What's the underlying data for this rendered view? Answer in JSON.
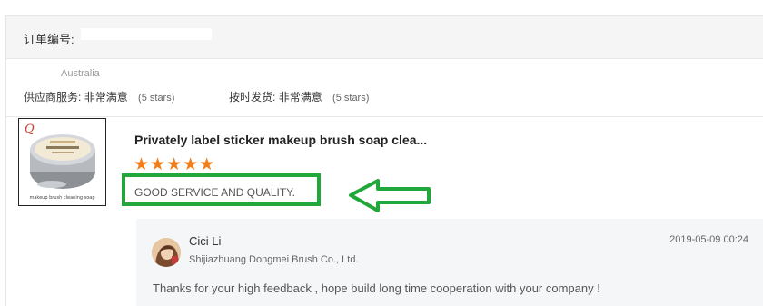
{
  "order": {
    "number_label": "订单编号:"
  },
  "buyer": {
    "country": "Australia"
  },
  "ratings": {
    "supplier_service": {
      "label": "供应商服务:",
      "value": "非常满意",
      "note": "(5 stars)"
    },
    "on_time_shipping": {
      "label": "按时发货:",
      "value": "非常满意",
      "note": "(5 stars)"
    }
  },
  "product": {
    "title": "Privately label sticker makeup brush soap clea...",
    "thumbnail_caption": "makeup brush cleaning soap",
    "stars_display": "★★★★★",
    "star_rating": 5,
    "star_color": "#f07f1a",
    "review_text": "GOOD SERVICE AND QUALITY."
  },
  "reply": {
    "name": "Cici Li",
    "company": "Shijiazhuang Dongmei Brush Co., Ltd.",
    "timestamp": "2019-05-09 00:24",
    "message": "Thanks for your high feedback , hope build long time cooperation with your company !"
  },
  "annotation": {
    "highlight_color": "#22a83a"
  }
}
